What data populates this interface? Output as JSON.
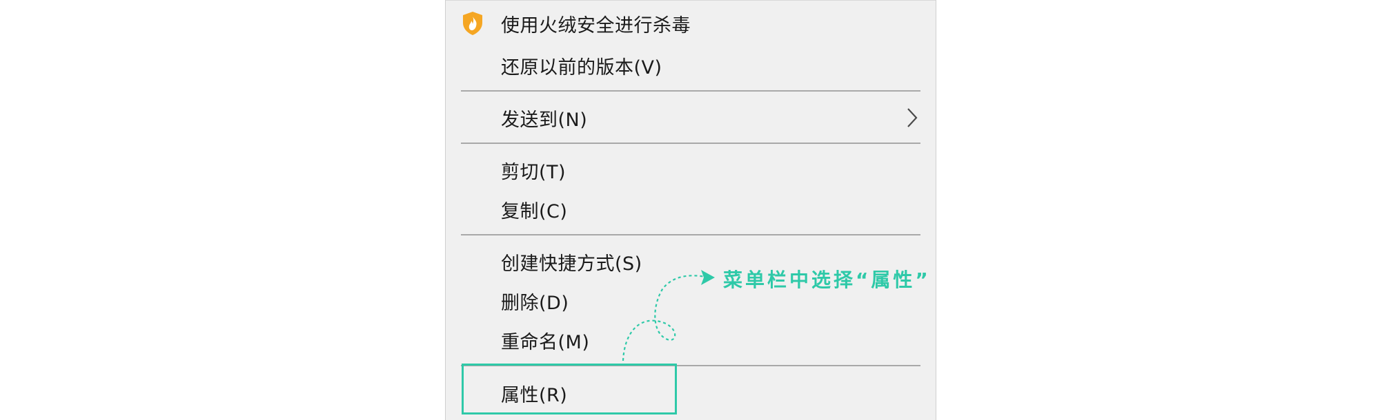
{
  "menu": {
    "items": [
      {
        "label": "使用火绒安全进行杀毒",
        "icon": "huorong-shield-icon"
      },
      {
        "label": "还原以前的版本(V)"
      },
      {
        "label": "发送到(N)",
        "submenu_icon": "chevron-right-icon"
      },
      {
        "label": "剪切(T)"
      },
      {
        "label": "复制(C)"
      },
      {
        "label": "创建快捷方式(S)"
      },
      {
        "label": "删除(D)"
      },
      {
        "label": "重命名(M)"
      },
      {
        "label": "属性(R)"
      }
    ]
  },
  "annotation": {
    "text": "菜单栏中选择“属性”",
    "color": "#2ec9a8"
  },
  "colors": {
    "menu_background": "#f0f0f0",
    "accent": "#2ec9a8",
    "shield_orange": "#f5a623"
  }
}
